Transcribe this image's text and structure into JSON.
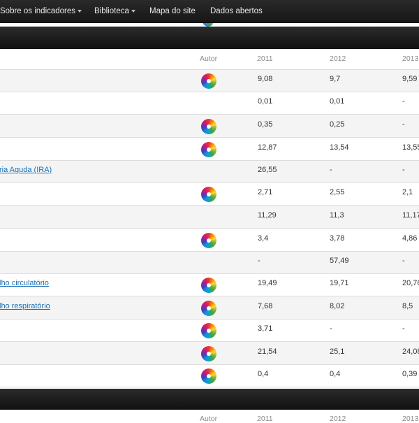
{
  "navbar": {
    "items": [
      {
        "label": "Sobre os indicadores",
        "dropdown": true
      },
      {
        "label": "Biblioteca",
        "dropdown": true
      },
      {
        "label": "Mapa do site",
        "dropdown": false
      },
      {
        "label": "Dados abertos",
        "dropdown": false
      }
    ]
  },
  "table": {
    "headers": {
      "author": "Autor",
      "years": [
        "2011",
        "2012",
        "2013"
      ]
    },
    "rows": [
      {
        "name": "",
        "author_icon": "author-logo-icon",
        "values": [
          "9,08",
          "9,7",
          "9,59"
        ]
      },
      {
        "name": "",
        "author_icon": "",
        "values": [
          "0,01",
          "0,01",
          "-"
        ]
      },
      {
        "name": "",
        "author_icon": "author-logo-icon",
        "values": [
          "0,35",
          "0,25",
          "-"
        ]
      },
      {
        "name": "",
        "author_icon": "author-logo-icon",
        "values": [
          "12,87",
          "13,54",
          "13,55"
        ]
      },
      {
        "name": "ria Aguda (IRA)",
        "author_icon": "",
        "values": [
          "26,55",
          "-",
          "-"
        ]
      },
      {
        "name": "",
        "author_icon": "author-logo-icon",
        "values": [
          "2,71",
          "2,55",
          "2,1"
        ]
      },
      {
        "name": "",
        "author_icon": "",
        "values": [
          "11,29",
          "11,3",
          "11,17"
        ]
      },
      {
        "name": "",
        "author_icon": "author-logo-icon",
        "values": [
          "3,4",
          "3,78",
          "4,86"
        ]
      },
      {
        "name": "",
        "author_icon": "",
        "values": [
          "-",
          "57,49",
          "-"
        ]
      },
      {
        "name": "lho circulatório",
        "author_icon": "author-logo-icon",
        "values": [
          "19,49",
          "19,71",
          "20,76"
        ]
      },
      {
        "name": "lho respiratório",
        "author_icon": "author-logo-icon",
        "values": [
          "7,68",
          "8,02",
          "8,5"
        ]
      },
      {
        "name": "",
        "author_icon": "author-logo-icon",
        "values": [
          "3,71",
          "-",
          "-"
        ]
      },
      {
        "name": "",
        "author_icon": "author-logo-icon",
        "values": [
          "21,54",
          "25,1",
          "24,08"
        ]
      },
      {
        "name": "",
        "author_icon": "author-logo-icon",
        "values": [
          "0,4",
          "0,4",
          "0,39"
        ]
      }
    ]
  },
  "next_table": {
    "headers": {
      "author": "Autor",
      "years": [
        "2011",
        "2012",
        "2013"
      ]
    }
  }
}
